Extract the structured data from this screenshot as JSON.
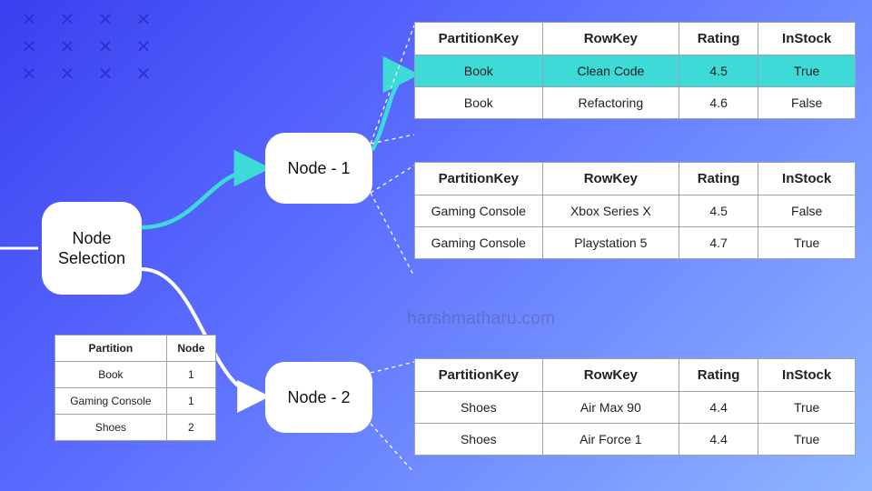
{
  "nodes": {
    "selection": "Node Selection",
    "node1": "Node - 1",
    "node2": "Node - 2"
  },
  "watermark": "harshmatharu.com",
  "partition_table": {
    "headers": {
      "partition": "Partition",
      "node": "Node"
    },
    "rows": [
      {
        "partition": "Book",
        "node": "1"
      },
      {
        "partition": "Gaming Console",
        "node": "1"
      },
      {
        "partition": "Shoes",
        "node": "2"
      }
    ]
  },
  "data_tables": {
    "headers": {
      "partitionKey": "PartitionKey",
      "rowKey": "RowKey",
      "rating": "Rating",
      "inStock": "InStock"
    },
    "t1": [
      {
        "partitionKey": "Book",
        "rowKey": "Clean Code",
        "rating": "4.5",
        "inStock": "True",
        "highlight": true
      },
      {
        "partitionKey": "Book",
        "rowKey": "Refactoring",
        "rating": "4.6",
        "inStock": "False"
      }
    ],
    "t2": [
      {
        "partitionKey": "Gaming Console",
        "rowKey": "Xbox Series X",
        "rating": "4.5",
        "inStock": "False"
      },
      {
        "partitionKey": "Gaming Console",
        "rowKey": "Playstation 5",
        "rating": "4.7",
        "inStock": "True"
      }
    ],
    "t3": [
      {
        "partitionKey": "Shoes",
        "rowKey": "Air Max 90",
        "rating": "4.4",
        "inStock": "True"
      },
      {
        "partitionKey": "Shoes",
        "rowKey": "Air Force 1",
        "rating": "4.4",
        "inStock": "True"
      }
    ]
  }
}
